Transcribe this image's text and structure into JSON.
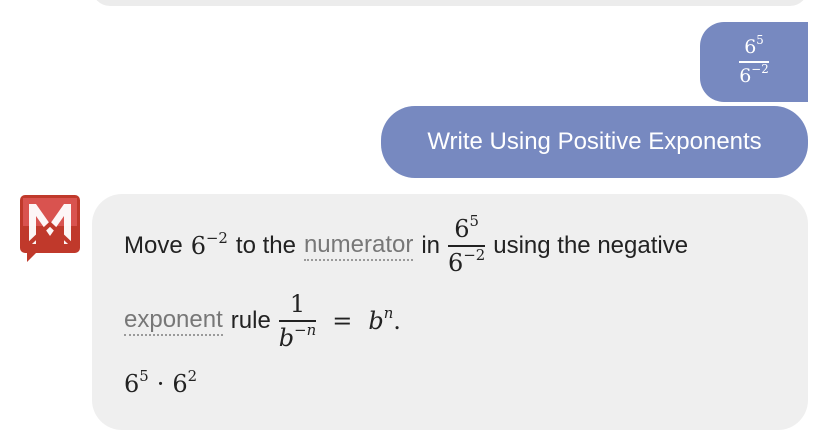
{
  "user": {
    "fraction": {
      "numerator_base": "6",
      "numerator_exp": "5",
      "denominator_base": "6",
      "denominator_exp": "−2"
    },
    "command": "Write Using Positive Exponents"
  },
  "answer": {
    "line1": {
      "move": "Move",
      "term_base": "6",
      "term_exp": "−2",
      "to_the": "to the",
      "numerator_link": "numerator",
      "in": "in",
      "frac_num_base": "6",
      "frac_num_exp": "5",
      "frac_den_base": "6",
      "frac_den_exp": "−2",
      "suffix": "using the negative"
    },
    "line2": {
      "exponent_link": "exponent",
      "rule": "rule",
      "rule_num": "1",
      "rule_den_base": "b",
      "rule_den_exp": "−n",
      "equals": "=",
      "rhs_base": "b",
      "rhs_exp": "n",
      "period": "."
    },
    "line3": {
      "a_base": "6",
      "a_exp": "5",
      "dot": "·",
      "b_base": "6",
      "b_exp": "2"
    }
  },
  "colors": {
    "bubble": "#7789c0",
    "card": "#efefef",
    "logo": "#c0392b"
  },
  "icons": {
    "logo": "mathway-logo-icon"
  }
}
